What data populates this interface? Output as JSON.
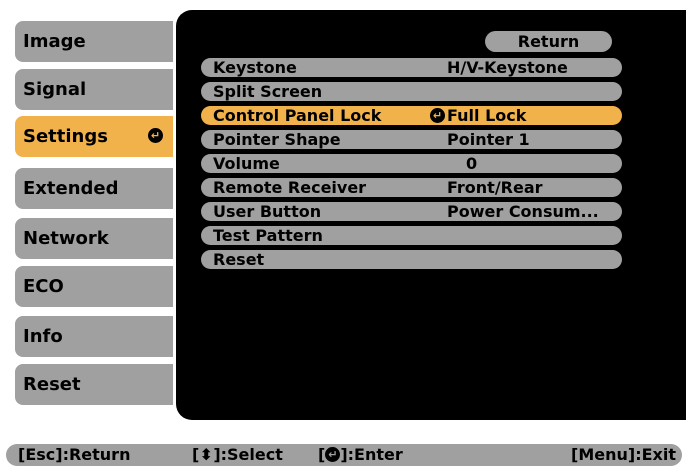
{
  "sidebar": {
    "items": [
      {
        "label": "Image"
      },
      {
        "label": "Signal"
      },
      {
        "label": "Settings",
        "active": true
      },
      {
        "label": "Extended"
      },
      {
        "label": "Network"
      },
      {
        "label": "ECO"
      },
      {
        "label": "Info"
      },
      {
        "label": "Reset"
      }
    ]
  },
  "main": {
    "return_label": "Return",
    "rows": [
      {
        "label": "Keystone",
        "value": "H/V-Keystone"
      },
      {
        "label": "Split Screen",
        "value": ""
      },
      {
        "label": "Control Panel Lock",
        "value": "Full Lock",
        "selected": true
      },
      {
        "label": "Pointer Shape",
        "value": "Pointer 1"
      },
      {
        "label": "Volume",
        "value": "0"
      },
      {
        "label": "Remote Receiver",
        "value": "Front/Rear"
      },
      {
        "label": "User Button",
        "value": "Power Consum..."
      },
      {
        "label": "Test Pattern",
        "value": ""
      },
      {
        "label": "Reset",
        "value": ""
      }
    ]
  },
  "footer": {
    "esc": "[Esc]:Return",
    "select_prefix": "[",
    "select_suffix": "]:Select",
    "enter_prefix": "[",
    "enter_suffix": "]:Enter",
    "menu": "[Menu]:Exit"
  },
  "colors": {
    "accent": "#f2b24b",
    "panel_bg": "#000000",
    "item_bg": "#a0a0a0"
  },
  "icons": {
    "enter": "enter-icon",
    "updown": "up-down-arrow-icon"
  }
}
